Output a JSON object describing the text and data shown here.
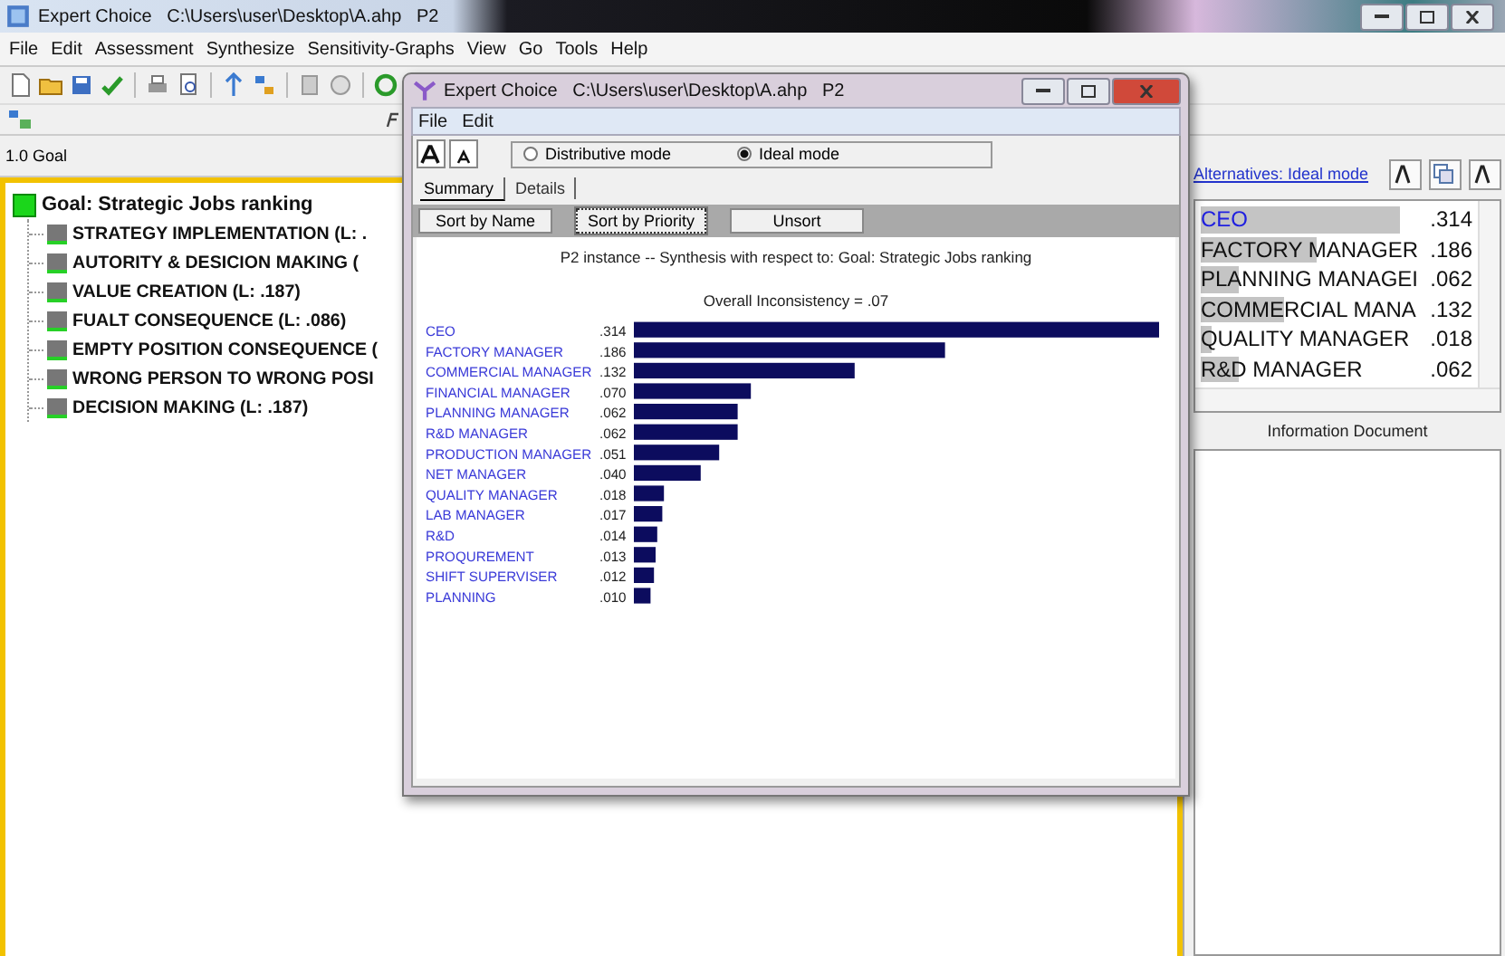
{
  "window": {
    "title": "Expert Choice   C:\\Users\\user\\Desktop\\A.ahp   P2"
  },
  "menu": [
    "File",
    "Edit",
    "Assessment",
    "Synthesize",
    "Sensitivity-Graphs",
    "View",
    "Go",
    "Tools",
    "Help"
  ],
  "goal_bar": {
    "text": "1.0 Goal"
  },
  "tree": {
    "label": "Goal: Strategic Jobs ranking",
    "children": [
      {
        "label": "STRATEGY IMPLEMENTATION (L: ."
      },
      {
        "label": "AUTORITY & DESICION MAKING ("
      },
      {
        "label": "VALUE CREATION (L: .187)"
      },
      {
        "label": "FUALT CONSEQUENCE (L: .086)"
      },
      {
        "label": "EMPTY POSITION CONSEQUENCE ("
      },
      {
        "label": "WRONG PERSON TO WRONG POSI"
      },
      {
        "label": "DECISION MAKING (L: .187)"
      }
    ]
  },
  "right_pane": {
    "link": "Alternatives: Ideal mode",
    "alternatives": [
      {
        "name": "CEO",
        "value": ".314",
        "level": 0.72,
        "selected": true
      },
      {
        "name": "FACTORY MANAGER",
        "value": ".186",
        "level": 0.42,
        "selected": false
      },
      {
        "name": "PLANNING MANAGEI",
        "value": ".062",
        "level": 0.14,
        "selected": false
      },
      {
        "name": "COMMERCIAL MANA",
        "value": ".132",
        "level": 0.3,
        "selected": false
      },
      {
        "name": "QUALITY MANAGER",
        "value": ".018",
        "level": 0.04,
        "selected": false
      },
      {
        "name": "R&D MANAGER",
        "value": ".062",
        "level": 0.14,
        "selected": false
      }
    ],
    "info_title": "Information Document"
  },
  "dialog": {
    "title": "Expert Choice   C:\\Users\\user\\Desktop\\A.ahp   P2",
    "menu": [
      "File",
      "Edit"
    ],
    "modes": [
      {
        "label": "Distributive mode",
        "selected": false
      },
      {
        "label": "Ideal mode",
        "selected": true
      }
    ],
    "tabs": [
      {
        "label": "Summary",
        "selected": true
      },
      {
        "label": "Details",
        "selected": false
      }
    ],
    "buttons": [
      {
        "label": "Sort by Name",
        "pressed": false
      },
      {
        "label": "Sort by Priority",
        "pressed": true
      },
      {
        "label": "Unsort",
        "pressed": false
      }
    ],
    "subtitle": "P2 instance -- Synthesis with respect to: Goal: Strategic Jobs ranking",
    "inconsistency": "Overall Inconsistency = .07",
    "chart_data": {
      "type": "bar",
      "orientation": "horizontal",
      "categories": [
        "CEO",
        "FACTORY MANAGER",
        "COMMERCIAL MANAGER",
        "FINANCIAL MANAGER",
        "PLANNING MANAGER",
        "R&D MANAGER",
        "PRODUCTION MANAGER",
        "NET MANAGER",
        "QUALITY MANAGER",
        "LAB MANAGER",
        "R&D",
        "PROQUREMENT",
        "SHIFT SUPERVISER",
        "PLANNING"
      ],
      "values": [
        0.314,
        0.186,
        0.132,
        0.07,
        0.062,
        0.062,
        0.051,
        0.04,
        0.018,
        0.017,
        0.014,
        0.013,
        0.012,
        0.01
      ],
      "value_labels": [
        ".314",
        ".186",
        ".132",
        ".070",
        ".062",
        ".062",
        ".051",
        ".040",
        ".018",
        ".017",
        ".014",
        ".013",
        ".012",
        ".010"
      ]
    }
  }
}
